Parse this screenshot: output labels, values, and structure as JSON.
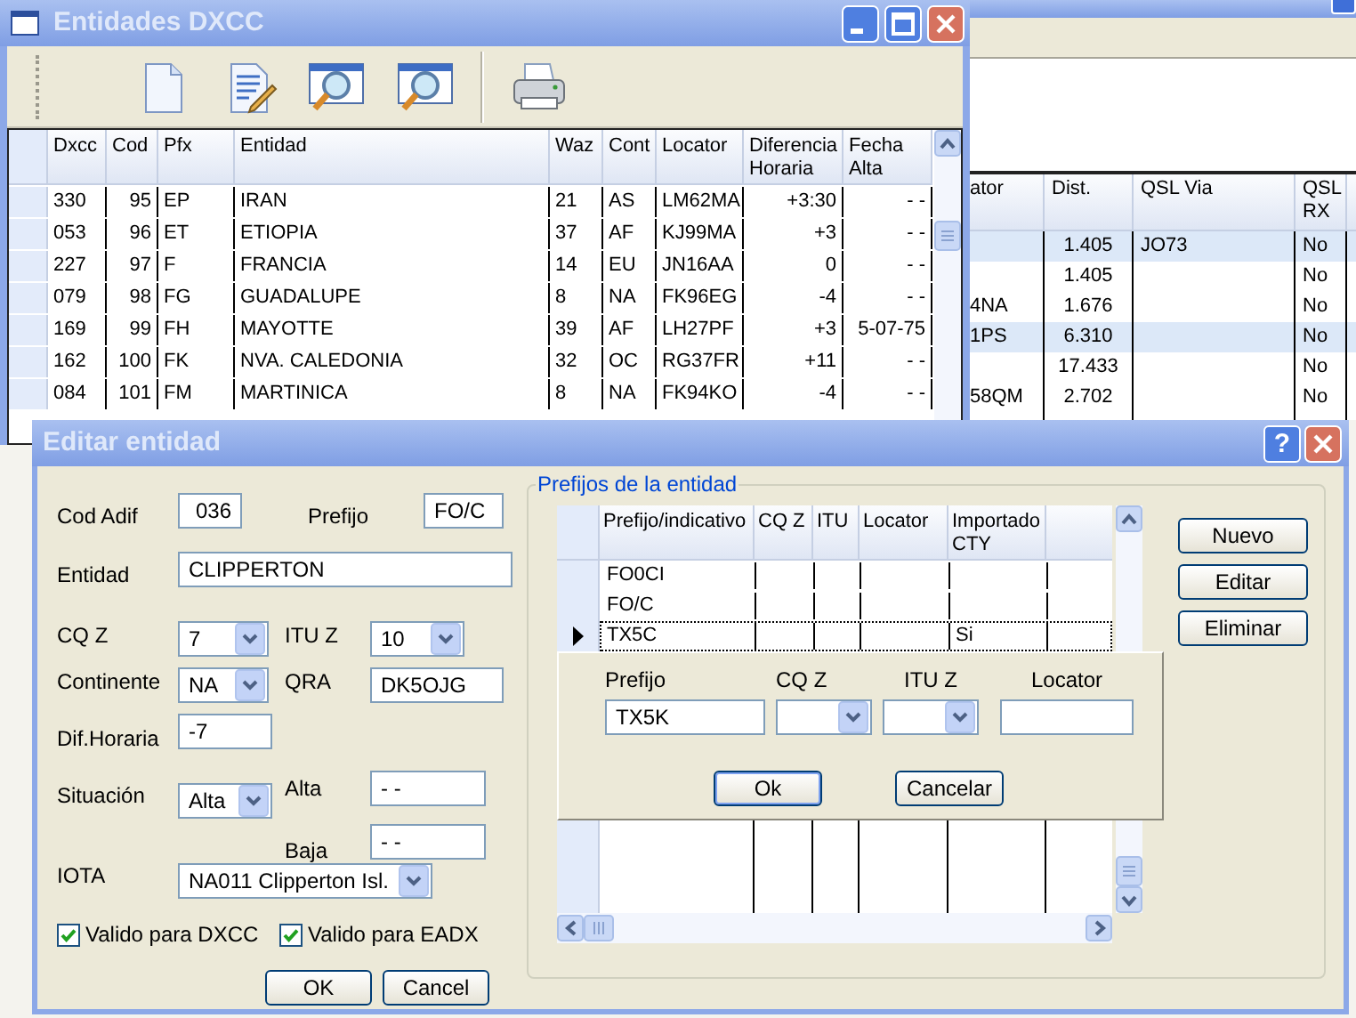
{
  "back_window": {
    "table": {
      "columns": [
        "ator",
        "Dist.",
        "QSL Via",
        "QSL RX"
      ],
      "rows": [
        {
          "cells": [
            null,
            "1.405",
            "JO73",
            "No"
          ],
          "selected": true
        },
        {
          "cells": [
            null,
            "1.405",
            null,
            "No"
          ],
          "selected": false
        },
        {
          "cells": [
            "4NA",
            "1.676",
            null,
            "No"
          ],
          "selected": false
        },
        {
          "cells": [
            "1PS",
            "6.310",
            null,
            "No"
          ],
          "selected": true
        },
        {
          "cells": [
            null,
            "17.433",
            null,
            "No"
          ],
          "selected": false
        },
        {
          "cells": [
            "58QM",
            "2.702",
            null,
            "No"
          ],
          "selected": false
        }
      ]
    }
  },
  "dxcc_window": {
    "title": "Entidades DXCC",
    "table": {
      "columns": [
        "Dxcc",
        "Cod",
        "Pfx",
        "Entidad",
        "Waz",
        "Cont",
        "Locator",
        "Diferencia Horaria",
        "Fecha Alta"
      ],
      "rows": [
        {
          "cells": [
            "330",
            "95",
            "EP",
            "IRAN",
            "21",
            "AS",
            "LM62MA",
            "+3:30",
            "- -"
          ]
        },
        {
          "cells": [
            "053",
            "96",
            "ET",
            "ETIOPIA",
            "37",
            "AF",
            "KJ99MA",
            "+3",
            "- -"
          ]
        },
        {
          "cells": [
            "227",
            "97",
            "F",
            "FRANCIA",
            "14",
            "EU",
            "JN16AA",
            "0",
            "- -"
          ]
        },
        {
          "cells": [
            "079",
            "98",
            "FG",
            "GUADALUPE",
            "8",
            "NA",
            "FK96EG",
            "-4",
            "- -"
          ]
        },
        {
          "cells": [
            "169",
            "99",
            "FH",
            "MAYOTTE",
            "39",
            "AF",
            "LH27PF",
            "+3",
            "5-07-75"
          ]
        },
        {
          "cells": [
            "162",
            "100",
            "FK",
            "NVA. CALEDONIA",
            "32",
            "OC",
            "RG37FR",
            "+11",
            "- -"
          ]
        },
        {
          "cells": [
            "084",
            "101",
            "FM",
            "MARTINICA",
            "8",
            "NA",
            "FK94KO",
            "-4",
            "- -"
          ]
        }
      ]
    }
  },
  "edit_dialog": {
    "title": "Editar entidad",
    "help_button": "?",
    "cod_adif": {
      "label": "Cod Adif",
      "value": "036"
    },
    "prefijo": {
      "label": "Prefijo",
      "value": "FO/C"
    },
    "entidad": {
      "label": "Entidad",
      "value": "CLIPPERTON"
    },
    "cq_z": {
      "label": "CQ Z",
      "value": "7"
    },
    "itu_z": {
      "label": "ITU Z",
      "value": "10"
    },
    "continente": {
      "label": "Continente",
      "value": "NA"
    },
    "qra": {
      "label": "QRA",
      "value": "DK5OJG"
    },
    "dif_horaria": {
      "label": "Dif.Horaria",
      "value": "-7"
    },
    "situacion": {
      "label": "Situación",
      "value": "Alta"
    },
    "alta": {
      "label": "Alta",
      "value": "- -"
    },
    "baja": {
      "label": "Baja",
      "value": "- -"
    },
    "iota": {
      "label": "IOTA",
      "value": "NA011 Clipperton Isl."
    },
    "checkboxes": [
      {
        "label": "Valido para DXCC",
        "checked": true
      },
      {
        "label": "Valido para EADX",
        "checked": true
      }
    ],
    "buttons": [
      "OK",
      "Cancel"
    ],
    "prefixes": {
      "title": "Prefijos de la entidad",
      "columns": [
        "Prefijo/indicativo",
        "CQ Z",
        "ITU",
        "Locator",
        "Importado CTY"
      ],
      "rows": [
        {
          "cells": [
            "FO0CI",
            null,
            null,
            null,
            null
          ],
          "selected": false
        },
        {
          "cells": [
            "FO/C",
            null,
            null,
            null,
            null
          ],
          "selected": false
        },
        {
          "cells": [
            "TX5C",
            null,
            null,
            null,
            "Si"
          ],
          "selected": true
        }
      ],
      "editor": {
        "fields": [
          {
            "label": "Prefijo",
            "kind": "text",
            "value": "TX5K"
          },
          {
            "label": "CQ Z",
            "kind": "select"
          },
          {
            "label": "ITU Z",
            "kind": "select"
          },
          {
            "label": "Locator",
            "kind": "text"
          }
        ],
        "buttons": [
          "Ok",
          "Cancelar"
        ]
      },
      "buttons": [
        "Nuevo",
        "Editar",
        "Eliminar"
      ]
    }
  }
}
